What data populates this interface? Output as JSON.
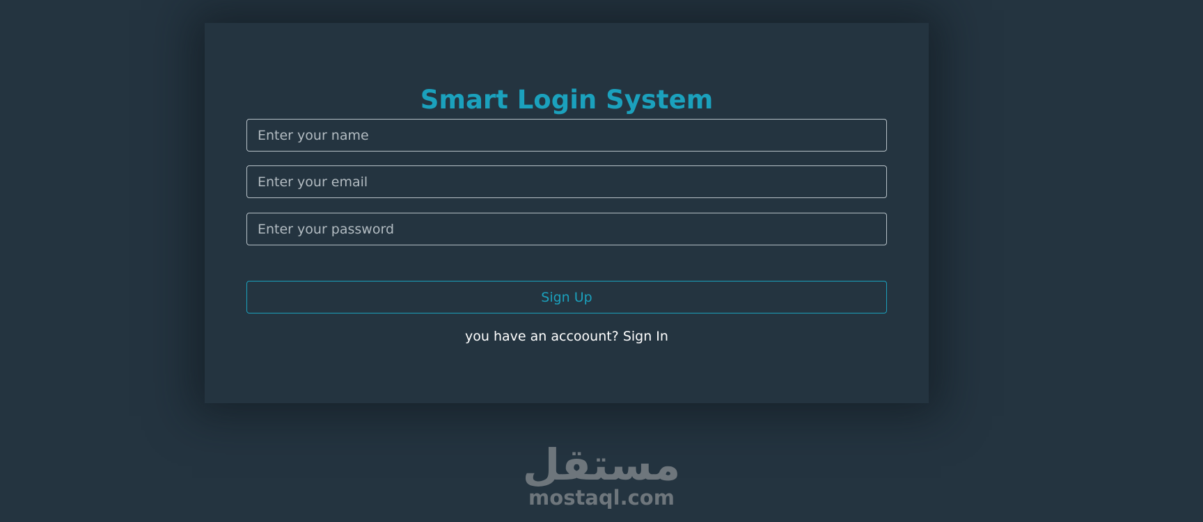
{
  "form": {
    "title": "Smart Login System",
    "name_placeholder": "Enter your name",
    "email_placeholder": "Enter your email",
    "password_placeholder": "Enter your password",
    "submit_label": "Sign Up",
    "switch_prompt": "you have an accoount?",
    "switch_link": "Sign In"
  },
  "watermark": {
    "arabic": "مستقل",
    "latin": "mostaql.com"
  },
  "colors": {
    "background": "#243440",
    "accent": "#1ba1bd",
    "input_border": "#b8c2c8",
    "text": "#ffffff",
    "watermark": "#6e767c"
  }
}
